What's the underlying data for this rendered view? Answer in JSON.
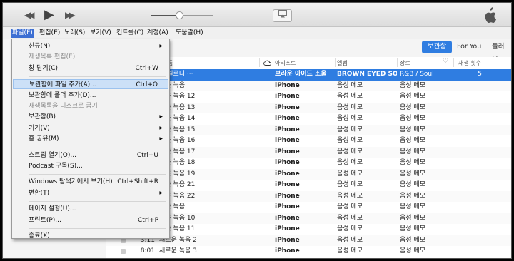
{
  "player": {
    "prev_icon": "◀◀",
    "play_icon": "▶",
    "next_icon": "▶▶",
    "volume_level": 0.45,
    "airplay_icon": "airplay-icon"
  },
  "menubar": [
    {
      "label": "파일(F)",
      "active": true
    },
    {
      "label": "편집(E)"
    },
    {
      "label": "노래(S)"
    },
    {
      "label": "보기(V)"
    },
    {
      "label": "컨트롤(C)"
    },
    {
      "label": "계정(A)"
    },
    {
      "label": "도움말(H)"
    }
  ],
  "tabs": {
    "library": "보관함",
    "for_you": "For You",
    "browse": "둘러보"
  },
  "table": {
    "headers": {
      "name": "름",
      "artist": "아티스트",
      "album": "앨범",
      "genre": "장르",
      "plays": "재생 횟수"
    },
    "rows": [
      {
        "time": "",
        "name": "리 멜로디 ···",
        "artist": "브라운 아이드 소울",
        "album": "BROWN EYED SOU...",
        "genre": "R&B / Soul",
        "plays": "5",
        "selected": true
      },
      {
        "time": "",
        "name": "로운 녹음",
        "artist": "iPhone",
        "album": "음성 메모",
        "genre": "음성 메모",
        "plays": ""
      },
      {
        "time": "",
        "name": "로운 녹음 12",
        "artist": "iPhone",
        "album": "음성 메모",
        "genre": "음성 메모",
        "plays": ""
      },
      {
        "time": "",
        "name": "로운 녹음 13",
        "artist": "iPhone",
        "album": "음성 메모",
        "genre": "음성 메모",
        "plays": ""
      },
      {
        "time": "",
        "name": "로운 녹음 14",
        "artist": "iPhone",
        "album": "음성 메모",
        "genre": "음성 메모",
        "plays": ""
      },
      {
        "time": "",
        "name": "로운 녹음 15",
        "artist": "iPhone",
        "album": "음성 메모",
        "genre": "음성 메모",
        "plays": ""
      },
      {
        "time": "",
        "name": "로운 녹음 16",
        "artist": "iPhone",
        "album": "음성 메모",
        "genre": "음성 메모",
        "plays": ""
      },
      {
        "time": "",
        "name": "로운 녹음 17",
        "artist": "iPhone",
        "album": "음성 메모",
        "genre": "음성 메모",
        "plays": ""
      },
      {
        "time": "",
        "name": "로운 녹음 18",
        "artist": "iPhone",
        "album": "음성 메모",
        "genre": "음성 메모",
        "plays": ""
      },
      {
        "time": "",
        "name": "로운 녹음 19",
        "artist": "iPhone",
        "album": "음성 메모",
        "genre": "음성 메모",
        "plays": ""
      },
      {
        "time": "",
        "name": "로운 녹음 21",
        "artist": "iPhone",
        "album": "음성 메모",
        "genre": "음성 메모",
        "plays": ""
      },
      {
        "time": "",
        "name": "로운 녹음 22",
        "artist": "iPhone",
        "album": "음성 메모",
        "genre": "음성 메모",
        "plays": ""
      },
      {
        "time": "",
        "name": "로운 녹음",
        "artist": "iPhone",
        "album": "음성 메모",
        "genre": "음성 메모",
        "plays": ""
      },
      {
        "time": "",
        "name": "로운 녹음 10",
        "artist": "iPhone",
        "album": "음성 메모",
        "genre": "음성 메모",
        "plays": ""
      },
      {
        "time": "",
        "name": "로운 녹음 11",
        "artist": "iPhone",
        "album": "음성 메모",
        "genre": "음성 메모",
        "plays": ""
      },
      {
        "time": "3:11",
        "name": "새로운 녹음 2",
        "artist": "iPhone",
        "album": "음성 메모",
        "genre": "음성 메모",
        "plays": ""
      },
      {
        "time": "8:01",
        "name": "새로운 녹음 3",
        "artist": "iPhone",
        "album": "음성 메모",
        "genre": "음성 메모",
        "plays": ""
      }
    ]
  },
  "file_menu": [
    {
      "label": "신규(N)",
      "submenu": true
    },
    {
      "label": "재생목록 편집(E)",
      "disabled": true
    },
    {
      "label": "창 닫기(C)",
      "shortcut": "Ctrl+W"
    },
    {
      "separator": true
    },
    {
      "label": "보관함에 파일 추가(A)...",
      "shortcut": "Ctrl+O",
      "highlighted": true
    },
    {
      "label": "보관함에 폴더 추가(D)..."
    },
    {
      "label": "재생목록을 디스크로 굽기",
      "disabled": true
    },
    {
      "label": "보관함(B)",
      "submenu": true
    },
    {
      "label": "기기(V)",
      "submenu": true
    },
    {
      "label": "홈 공유(M)",
      "submenu": true
    },
    {
      "separator": true
    },
    {
      "label": "스트림 열기(O)...",
      "shortcut": "Ctrl+U"
    },
    {
      "label": "Podcast 구독(S)..."
    },
    {
      "separator": true
    },
    {
      "label": "Windows 탐색기에서 보기(H)",
      "shortcut": "Ctrl+Shift+R"
    },
    {
      "label": "변환(T)",
      "submenu": true
    },
    {
      "separator": true
    },
    {
      "label": "페이지 설정(U)..."
    },
    {
      "label": "프린트(P)...",
      "shortcut": "Ctrl+P"
    },
    {
      "separator": true
    },
    {
      "label": "종료(X)"
    }
  ],
  "colors": {
    "accent": "#2f7de1",
    "menu_highlight": "#cce0f7"
  }
}
